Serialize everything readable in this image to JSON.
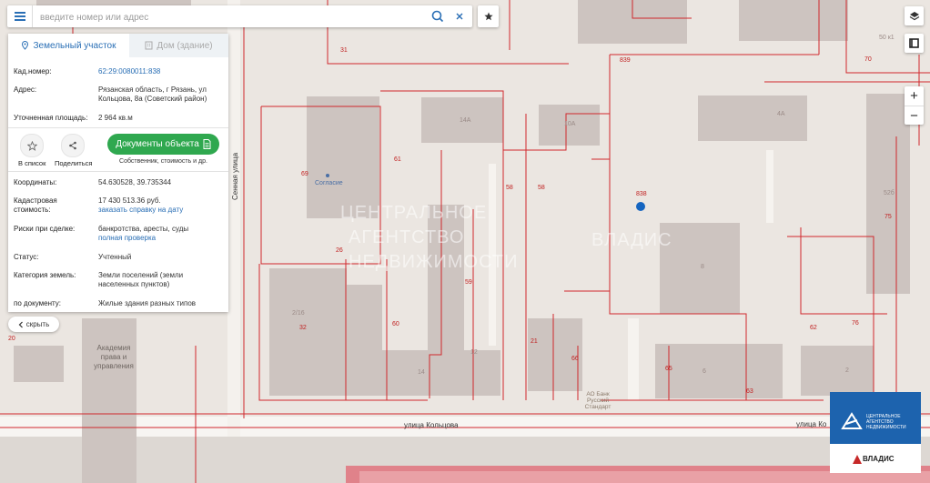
{
  "search": {
    "placeholder": "введите номер или адрес"
  },
  "tabs": [
    {
      "label": "Земельный участок"
    },
    {
      "label": "Дом (здание)"
    }
  ],
  "info": {
    "cad_label": "Кад.номер:",
    "cad_value": "62:29:0080011:838",
    "address_label": "Адрес:",
    "address_value": "Рязанская область, г Рязань, ул Кольцова, 8а (Советский район)",
    "area_label": "Уточненная площадь:",
    "area_value": "2 964 кв.м",
    "coords_label": "Координаты:",
    "coords_value": "54.630528, 39.735344",
    "cost_label": "Кадастровая стоимость:",
    "cost_value": "17 430 513.36 руб.",
    "cost_link": "заказать справку на дату",
    "risks_label": "Риски при сделке:",
    "risks_value": "банкротства, аресты, суды",
    "risks_link": "полная проверка",
    "status_label": "Статус:",
    "status_value": "Учтенный",
    "category_label": "Категория земель:",
    "category_value": "Земли поселений (земли населенных пунктов)",
    "doc_label": "по документу:",
    "doc_value": "Жилые здания разных типов"
  },
  "actions": {
    "list_label": "В список",
    "share_label": "Поделиться",
    "docs_label": "Документы объекта",
    "docs_sub": "Собственник, стоимость и др."
  },
  "hide_label": "скрыть",
  "map": {
    "parcel_labels": [
      "31",
      "839",
      "70",
      "61",
      "69",
      "58",
      "58",
      "838",
      "26",
      "59",
      "60",
      "21",
      "66",
      "65",
      "63",
      "62",
      "76",
      "75",
      "32",
      "20"
    ],
    "building_labels": [
      "14А",
      "10А",
      "4А",
      "8",
      "2/16",
      "14",
      "12",
      "6",
      "2",
      "52б",
      "50 к1"
    ],
    "poi": [
      "Согласие",
      "Академия права и управления",
      "АО Банк Русский Стандарт"
    ],
    "streets": [
      "Сенная улица",
      "улица Кольцова",
      "улица Ко"
    ],
    "watermark": [
      "ЦЕНТРАЛЬНОЕ",
      "АГЕНТСТВО",
      "НЕДВИЖИМОСТИ",
      "ВЛАДИС"
    ]
  },
  "logo": {
    "line1": "ЦЕНТРАЛЬНОЕ АГЕНТСТВО НЕДВИЖИМОСТИ",
    "brand": "ВЛАДИС"
  },
  "colors": {
    "accent": "#2a6fb5",
    "docs_button": "#2fa84f",
    "parcel_line": "#d0282d",
    "logo_blue": "#1d63ae"
  }
}
